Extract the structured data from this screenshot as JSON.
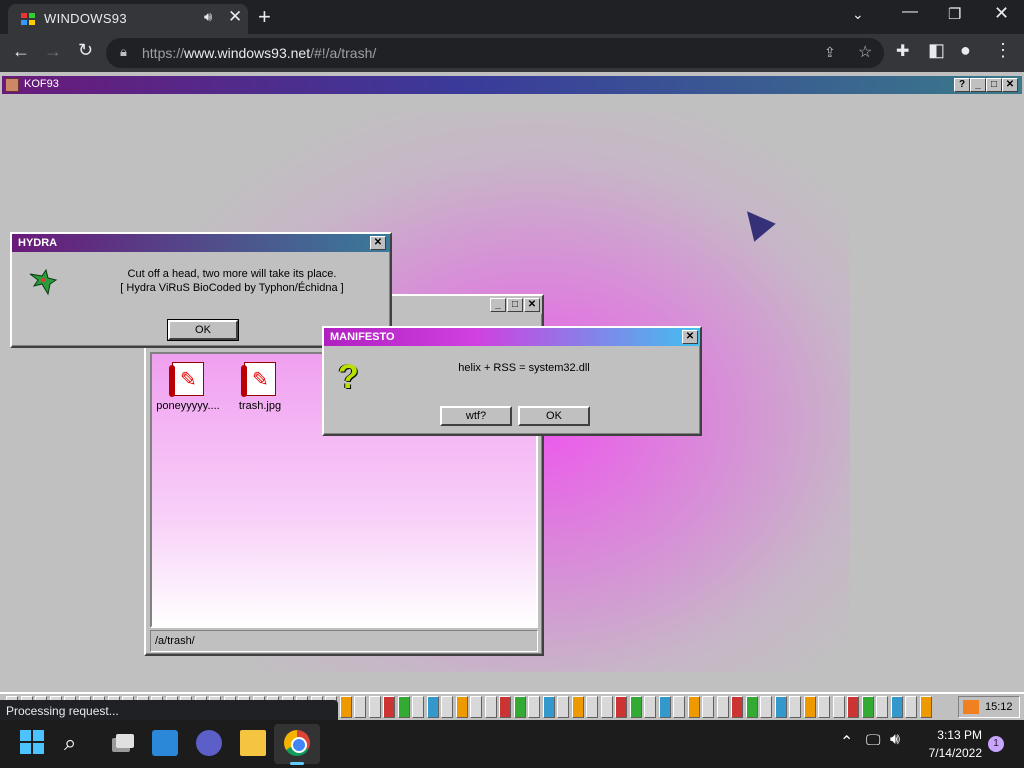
{
  "browser": {
    "tab_title": "WINDOWS93",
    "url_prefix": "https://",
    "url_host": "www.windows93.net",
    "url_path": "/#!/a/trash/",
    "status_text": "Processing request..."
  },
  "desktop": {
    "main_window_title": "KOF93",
    "explorer": {
      "files": [
        {
          "name": "poneyyyyy...."
        },
        {
          "name": "trash.jpg"
        }
      ],
      "path": "/a/trash/"
    },
    "hydra": {
      "title": "HYDRA",
      "line1": "Cut off a head, two more will take its place.",
      "line2": "[ Hydra ViRuS BioCoded by Typhon/Échidna ]",
      "ok_label": "OK"
    },
    "manifesto": {
      "title": "MANIFESTO",
      "message": "helix + RSS = system32.dll",
      "wtf_label": "wtf?",
      "ok_label": "OK"
    },
    "taskbar_clock": "15:12",
    "rss_badge": "RSS"
  },
  "os_taskbar": {
    "time": "3:13 PM",
    "date": "7/14/2022",
    "notifications": "1"
  },
  "colors": {
    "accent_magenta": "#f050f0",
    "chrome_bg": "#202124"
  }
}
